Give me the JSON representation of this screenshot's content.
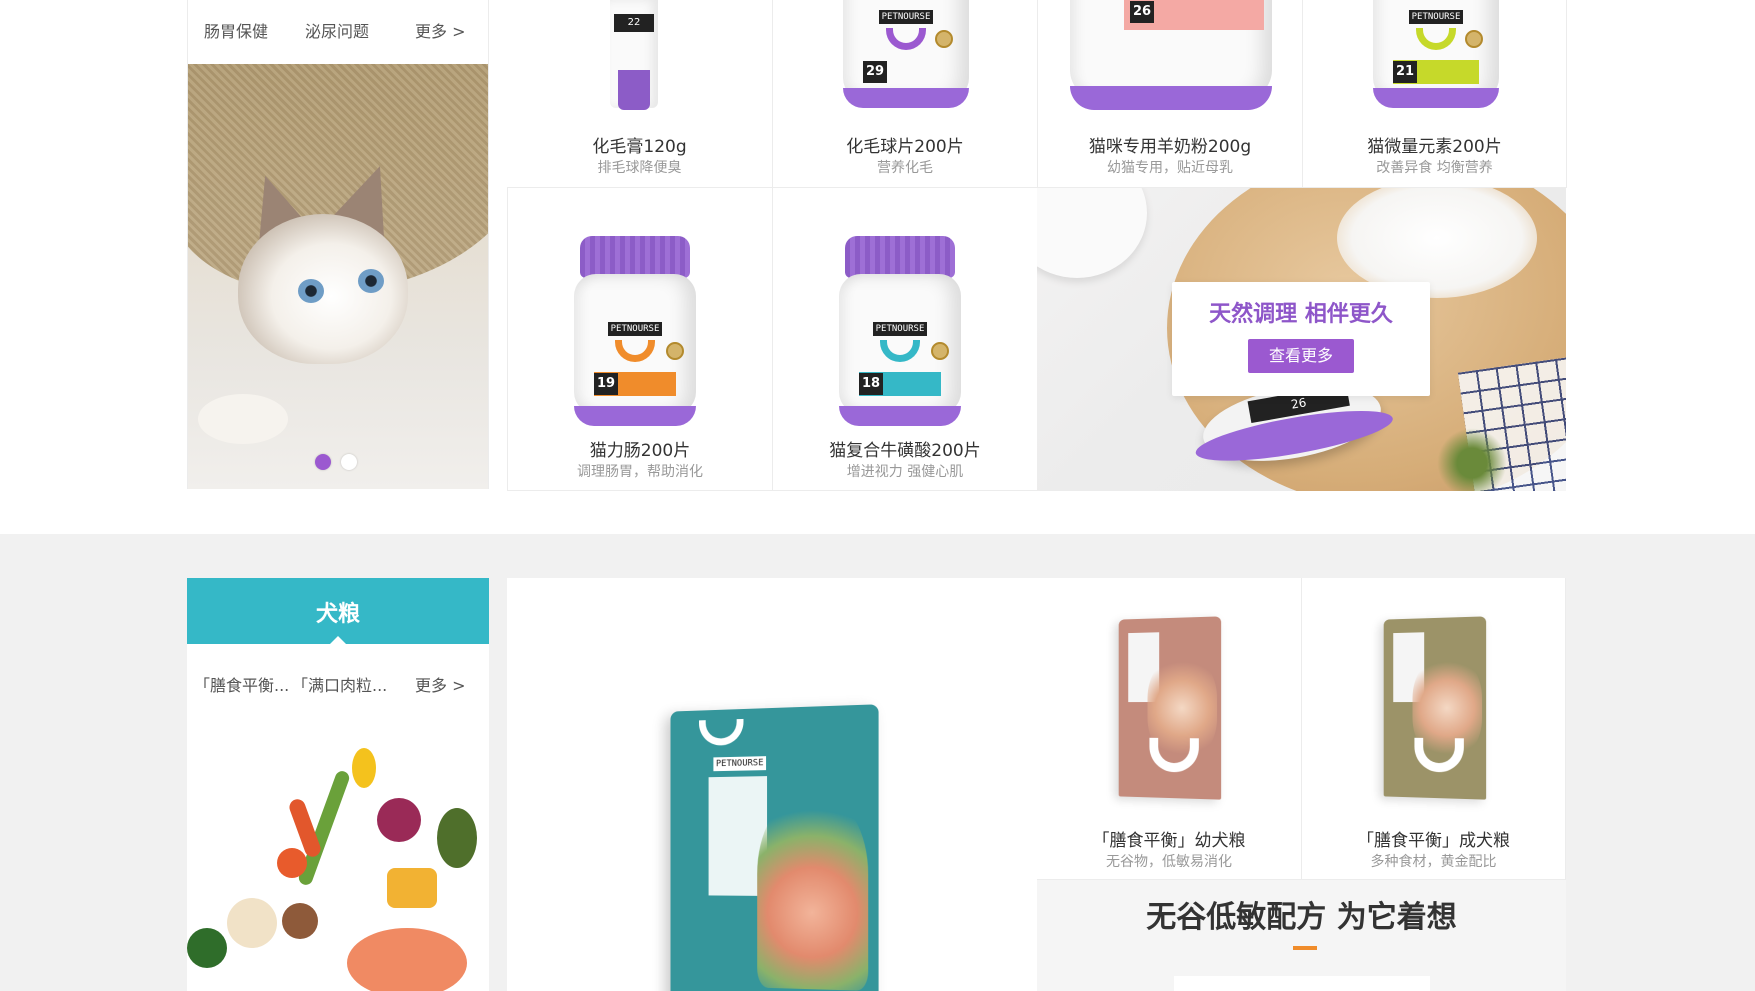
{
  "cat_section": {
    "sub_tabs": [
      "肠胃保健",
      "泌尿问题"
    ],
    "more": "更多 >",
    "carousel": {
      "slides": 2,
      "active_index": 0
    },
    "products": [
      {
        "name": "化毛膏120g",
        "desc": "排毛球降便臭"
      },
      {
        "name": "化毛球片200片",
        "desc": "营养化毛"
      },
      {
        "name": "猫咪专用羊奶粉200g",
        "desc": "幼猫专用，贴近母乳"
      },
      {
        "name": "猫微量元素200片",
        "desc": "改善异食 均衡营养"
      },
      {
        "name": "猫力肠200片",
        "desc": "调理肠胃，帮助消化"
      },
      {
        "name": "猫复合牛磺酸200片",
        "desc": "增进视力 强健心肌"
      }
    ],
    "jar_labels": {
      "tube_num": "22",
      "jar1_num": "29",
      "jar2_num": "26",
      "jar3_num": "21",
      "jar4_num": "19",
      "jar5_num": "18",
      "brand": "PETNOURSE"
    },
    "promo": {
      "title": "天然调理 相伴更久",
      "button": "查看更多",
      "jar_num": "26"
    },
    "colors": {
      "accent_purple": "#9b59d0",
      "teal": "#35b8c7",
      "pink": "#f2a7a7",
      "lime": "#c6d92a",
      "orange": "#f08c2b"
    }
  },
  "dog_section": {
    "title": "犬粮",
    "sub_tabs": [
      "「膳食平衡...",
      "「满口肉粒..."
    ],
    "more": "更多 >",
    "products": [
      {
        "name": "「膳食平衡」幼犬粮",
        "desc": "无谷物，低敏易消化"
      },
      {
        "name": "「膳食平衡」成犬粮",
        "desc": "多种食材，黄金配比"
      }
    ],
    "banner": {
      "title": "无谷低敏配方 为它着想"
    }
  }
}
